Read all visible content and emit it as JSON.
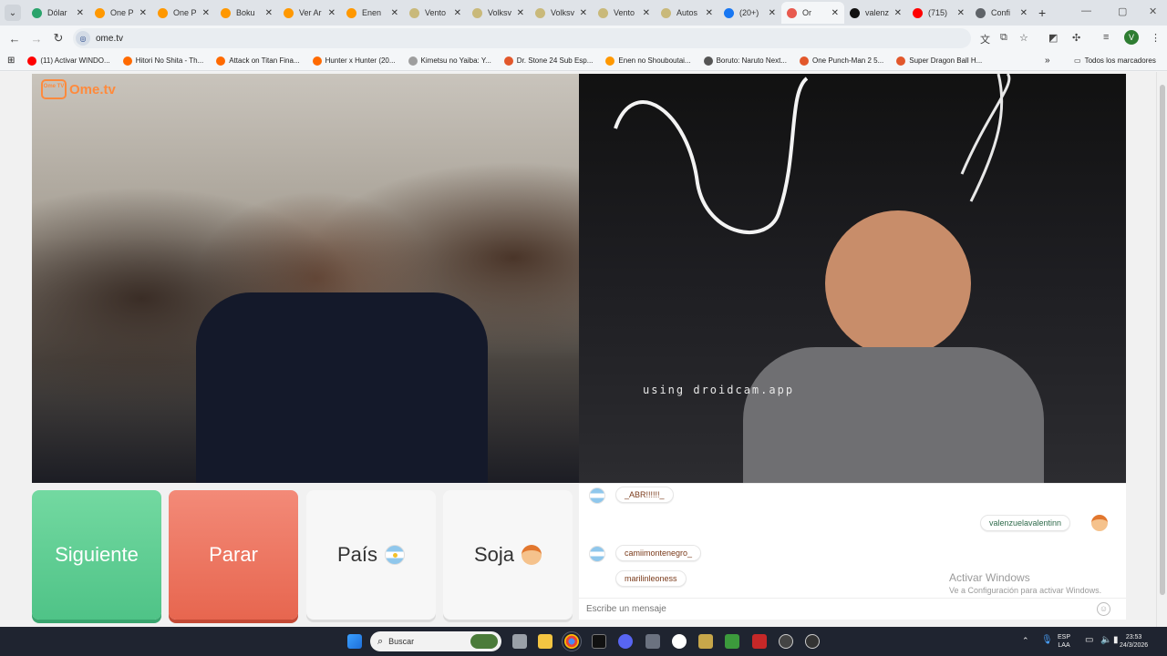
{
  "browser": {
    "tabs": [
      {
        "label": "Dólar",
        "color": "#2aa36b",
        "active": false
      },
      {
        "label": "One P",
        "color": "#ff9800",
        "active": false
      },
      {
        "label": "One P",
        "color": "#ff9800",
        "active": false
      },
      {
        "label": "Boku",
        "color": "#ff9800",
        "active": false
      },
      {
        "label": "Ver Ar",
        "color": "#ff9800",
        "active": false
      },
      {
        "label": "Enen",
        "color": "#ff9800",
        "active": false
      },
      {
        "label": "Vento",
        "color": "#c9b97a",
        "active": false
      },
      {
        "label": "Volksv",
        "color": "#c9b97a",
        "active": false
      },
      {
        "label": "Volksv",
        "color": "#c9b97a",
        "active": false
      },
      {
        "label": "Vento",
        "color": "#c9b97a",
        "active": false
      },
      {
        "label": "Autos",
        "color": "#c9b97a",
        "active": false
      },
      {
        "label": "(20+)",
        "color": "#1877f2",
        "active": false
      },
      {
        "label": "Or",
        "color": "#e85a4f",
        "active": true
      },
      {
        "label": "valenz",
        "color": "#111111",
        "active": false
      },
      {
        "label": "(715)",
        "color": "#ff0000",
        "active": false
      },
      {
        "label": "Confi",
        "color": "#5f6368",
        "active": false
      }
    ],
    "url": "ome.tv",
    "profile_initial": "V",
    "bookmarks": [
      {
        "label": "(11) Activar WINDO...",
        "color": "#ff0000"
      },
      {
        "label": "Hitori No Shita - Th...",
        "color": "#ff6a00"
      },
      {
        "label": "Attack on Titan Fina...",
        "color": "#ff6a00"
      },
      {
        "label": "Hunter x Hunter (20...",
        "color": "#ff6a00"
      },
      {
        "label": "Kimetsu no Yaiba: Y...",
        "color": "#9e9e9e"
      },
      {
        "label": "Dr. Stone 24 Sub Esp...",
        "color": "#e2572b"
      },
      {
        "label": "Enen no Shouboutai...",
        "color": "#ff9800"
      },
      {
        "label": "Boruto: Naruto Next...",
        "color": "#555555"
      },
      {
        "label": "One Punch-Man 2 5...",
        "color": "#e2572b"
      },
      {
        "label": "Super Dragon Ball H...",
        "color": "#e2572b"
      }
    ],
    "all_bookmarks": "Todos los marcadores"
  },
  "ometv": {
    "logo_text": "Ome.tv",
    "logo_badge": "Ome TV",
    "watermark": "using droidcam.app",
    "buttons": {
      "next": "Siguiente",
      "stop": "Parar",
      "country": "País",
      "gender": "Soja"
    },
    "chat": {
      "messages": [
        {
          "user": "_ABR!!!!!!_",
          "side": "left"
        },
        {
          "user": "valenzuelavalentinn",
          "side": "right"
        },
        {
          "user": "camiimontenegro_",
          "side": "left"
        },
        {
          "user": "marilinleoness",
          "side": "left"
        }
      ],
      "placeholder": "Escribe un mensaje",
      "activate_title": "Activar Windows",
      "activate_sub": "Ve a Configuración para activar Windows."
    },
    "colors": {
      "next": "#5fcf93",
      "stop": "#ec765f",
      "accent": "#ff8a3c"
    }
  },
  "taskbar": {
    "search_placeholder": "Buscar",
    "lang": "ESP",
    "lang_sub": "LAA",
    "time": "23:53",
    "date": "24/3/2026"
  }
}
